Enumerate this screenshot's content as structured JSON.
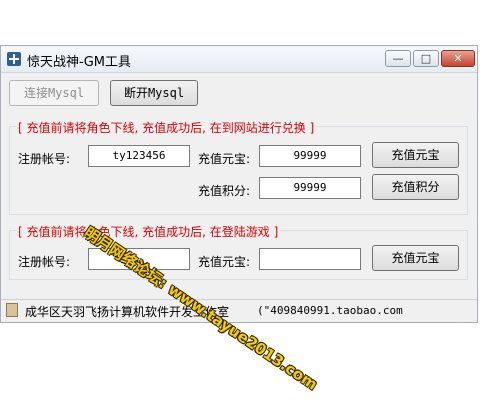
{
  "window": {
    "title": "惊天战神-GM工具",
    "controls": {
      "minimize": "—",
      "maximize": "□",
      "close": "✕"
    },
    "close_color": "#c2452d"
  },
  "toolbar": {
    "connect_label": "连接Mysql",
    "disconnect_label": "断开Mysql"
  },
  "group1": {
    "legend": "[ 充值前请将角色下线, 充值成功后, 在到网站进行兑换 ]",
    "account_label": "注册帐号:",
    "account_value": "ty123456",
    "yuanbao_label": "充值元宝:",
    "yuanbao_value": "99999",
    "yuanbao_button": "充值元宝",
    "points_label": "充值积分:",
    "points_value": "99999",
    "points_button": "充值积分"
  },
  "group2": {
    "legend": "[ 充值前请将角色下线, 充值成功后, 在登陆游戏 ]",
    "account_label": "注册帐号:",
    "account_value": "",
    "yuanbao_label": "充值元宝:",
    "yuanbao_value": "",
    "yuanbao_button": "充值元宝"
  },
  "statusbar": {
    "icon": "book-icon",
    "text": "成华区天羽飞扬计算机软件开发工作室",
    "link": "(\"409840991.taobao.com"
  },
  "watermark": {
    "text": "明月网络论坛: www.tayue2013.com"
  },
  "colors": {
    "legend_text": "#e00000",
    "watermark": "#f0d000"
  }
}
